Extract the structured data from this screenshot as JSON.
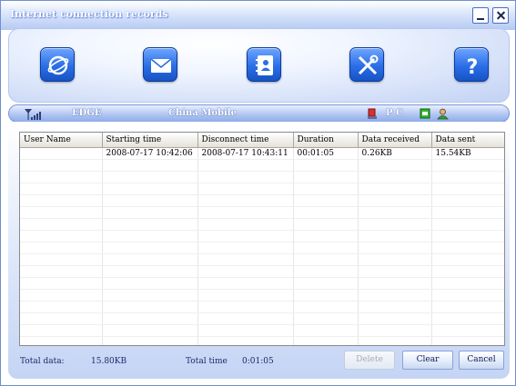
{
  "window": {
    "title": "Internet connection records"
  },
  "status": {
    "network_type": "EDGE",
    "operator": "China Mobile",
    "pc_label": "P C"
  },
  "table": {
    "columns": [
      "User Name",
      "Starting time",
      "Disconnect time",
      "Duration",
      "Data received",
      "Data sent"
    ],
    "rows": [
      [
        "",
        "2008-07-17  10:42:06",
        "2008-07-17  10:43:11",
        "00:01:05",
        "0.26KB",
        "15.54KB"
      ]
    ],
    "empty_rows": 16
  },
  "footer": {
    "total_data_label": "Total data:",
    "total_data_value": "15.80KB",
    "total_time_label": "Total time",
    "total_time_value": "0:01:05",
    "delete_label": "Delete",
    "clear_label": "Clear",
    "cancel_label": "Cancel"
  },
  "icons": {
    "toolbar": [
      "internet-globe-icon",
      "message-envelope-icon",
      "contacts-book-icon",
      "settings-tools-icon",
      "help-question-icon"
    ]
  },
  "colors": {
    "accent": "#2b6ee6",
    "panel": "#c4d4f4"
  }
}
